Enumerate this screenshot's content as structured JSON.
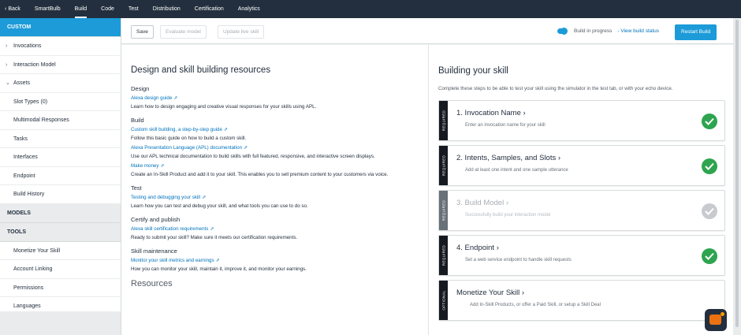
{
  "topnav": {
    "back": "Back",
    "items": [
      "SmartBulb",
      "Build",
      "Code",
      "Test",
      "Distribution",
      "Certification",
      "Analytics"
    ],
    "active": "Build"
  },
  "sidebar": {
    "custom_header": "CUSTOM",
    "items": [
      {
        "label": "Invocations",
        "chevron": "right"
      },
      {
        "label": "Interaction Model",
        "chevron": "right"
      },
      {
        "label": "Assets",
        "chevron": "down"
      },
      {
        "label": "Slot Types (0)"
      },
      {
        "label": "Multimodal Responses"
      },
      {
        "label": "Tasks"
      },
      {
        "label": "Interfaces"
      },
      {
        "label": "Endpoint"
      },
      {
        "label": "Build History"
      }
    ],
    "models_header": "MODELS",
    "tools_header": "TOOLS",
    "tools_items": [
      "Monetize Your Skill",
      "Account Linking",
      "Permissions",
      "Languages"
    ]
  },
  "toolbar": {
    "save": "Save",
    "evaluate": "Evaluate model",
    "update": "Update live skill",
    "progress": "Build in progress",
    "view_status": "- View build status",
    "restart": "Restart Build"
  },
  "left_panel": {
    "title": "Design and skill building resources",
    "groups": {
      "design": {
        "heading": "Design",
        "link": "Alexa design guide",
        "desc": "Learn how to design engaging and creative visual responses for your skills using APL."
      },
      "build": {
        "heading": "Build",
        "link1": "Custom skill building, a step-by-step guide",
        "desc1": "Follow this basic guide on how to build a custom skill.",
        "link2": "Alexa Presentation Language (APL) documentation",
        "desc2": "Use our APL technical documentation to build skills with full featured, responsive, and interactive screen displays.",
        "link3": "Make money",
        "desc3": "Create an In-Skill Product and add it to your skill. This enables you to sell premium content to your customers via voice."
      },
      "test": {
        "heading": "Test",
        "link": "Testing and debugging your skill",
        "desc": "Learn how you can test and debug your skill, and what tools you can use to do so."
      },
      "certify": {
        "heading": "Certify and publish",
        "link": "Alexa skill certification requirements",
        "desc": "Ready to submit your skill? Make sure it meets our certification requirements."
      },
      "maintenance": {
        "heading": "Skill maintenance",
        "link": "Monitor your skill metrics and earnings",
        "desc": "How you can monitor your skill, maintain it, improve it, and monitor your earnings."
      }
    },
    "resources_peek": "Resources"
  },
  "right_panel": {
    "title": "Building your skill",
    "subtitle": "Complete these steps to be able to test your skill using the simulator in the test tab, or with your echo device.",
    "steps": [
      {
        "tag": "REQUIRED",
        "title": "1. Invocation Name",
        "desc": "Enter an invocation name for your skill",
        "status": "complete"
      },
      {
        "tag": "REQUIRED",
        "title": "2. Intents, Samples, and Slots",
        "desc": "Add at least one intent and one sample utterance",
        "status": "complete"
      },
      {
        "tag": "REQUIRED",
        "title": "3. Build Model",
        "desc": "Successfully build your interaction model",
        "status": "disabled"
      },
      {
        "tag": "REQUIRED",
        "title": "4. Endpoint",
        "desc": "Set a web service endpoint to handle skill requests",
        "status": "complete"
      },
      {
        "tag": "OPTIONAL",
        "title": "Monetize Your Skill",
        "desc": "Add In-Skill Products, or offer a Paid Skill, or setup a Skill Deal",
        "status": "none"
      }
    ]
  },
  "colors": {
    "topnav_bg": "#232f3e",
    "accent": "#1c9bd8",
    "link": "#0073bb",
    "success": "#2ea44f"
  }
}
